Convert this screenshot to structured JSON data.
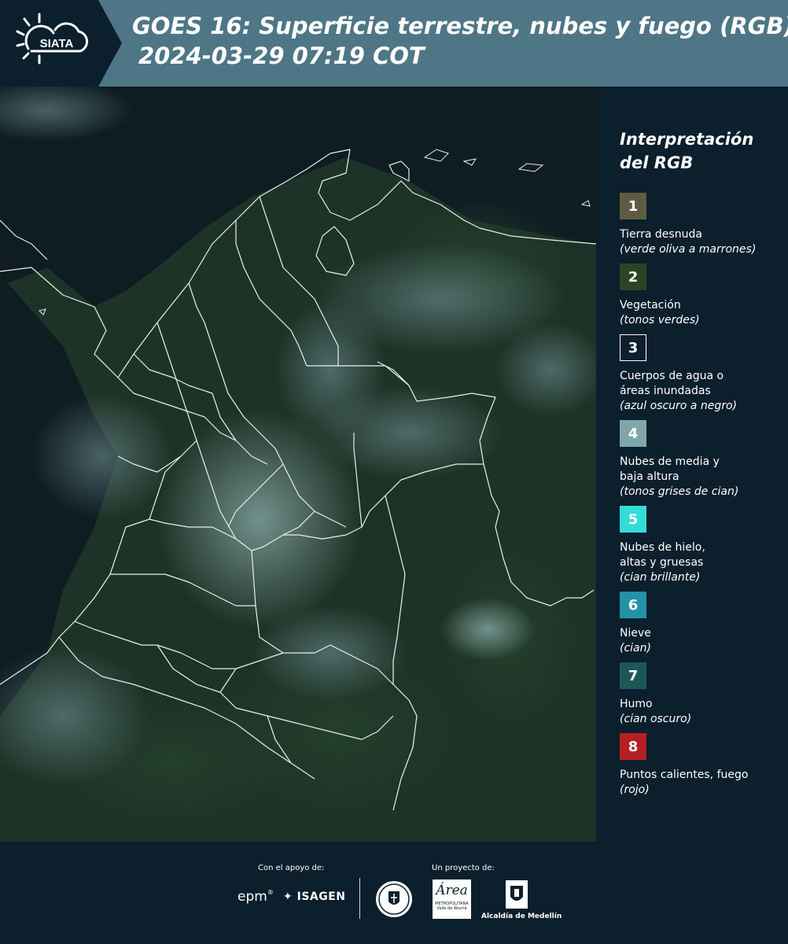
{
  "header": {
    "logo_text": "SIATA",
    "title_line1": "GOES 16: Superficie terrestre, nubes y fuego (RGB)",
    "title_line2": "2024-03-29 07:19 COT"
  },
  "legend": {
    "title_line1": "Interpretación",
    "title_line2": "del RGB",
    "items": [
      {
        "number": "1",
        "name": "Tierra desnuda",
        "desc": "(verde oliva a marrones)",
        "color": "#5d5c43"
      },
      {
        "number": "2",
        "name": "Vegetación",
        "desc": "(tonos verdes)",
        "color": "#2c4324"
      },
      {
        "number": "3",
        "name": "Cuerpos de agua o áreas inundadas",
        "desc": "(azul oscuro a negro)",
        "color": "#0b1f2c"
      },
      {
        "number": "4",
        "name": "Nubes de media y baja altura",
        "desc": "(tonos grises de cian)",
        "color": "#7fa7a8"
      },
      {
        "number": "5",
        "name": "Nubes de hielo, altas y gruesas",
        "desc": "(cian brillante)",
        "color": "#35dbd9"
      },
      {
        "number": "6",
        "name": "Nieve",
        "desc": "(cian)",
        "color": "#2491a4"
      },
      {
        "number": "7",
        "name": "Humo",
        "desc": "(cian oscuro)",
        "color": "#1d5859"
      },
      {
        "number": "8",
        "name": "Puntos calientes, fuego",
        "desc": "(rojo)",
        "color": "#b52024"
      }
    ]
  },
  "footer": {
    "support_label": "Con el apoyo de:",
    "project_label": "Un proyecto de:",
    "epm": "epm",
    "isagen": "ISAGEN",
    "area_main": "Área",
    "area_sub": "METROPOLITANA",
    "area_sub2": "Valle de Aburrá",
    "alcaldia": "Alcaldía de Medellín"
  }
}
